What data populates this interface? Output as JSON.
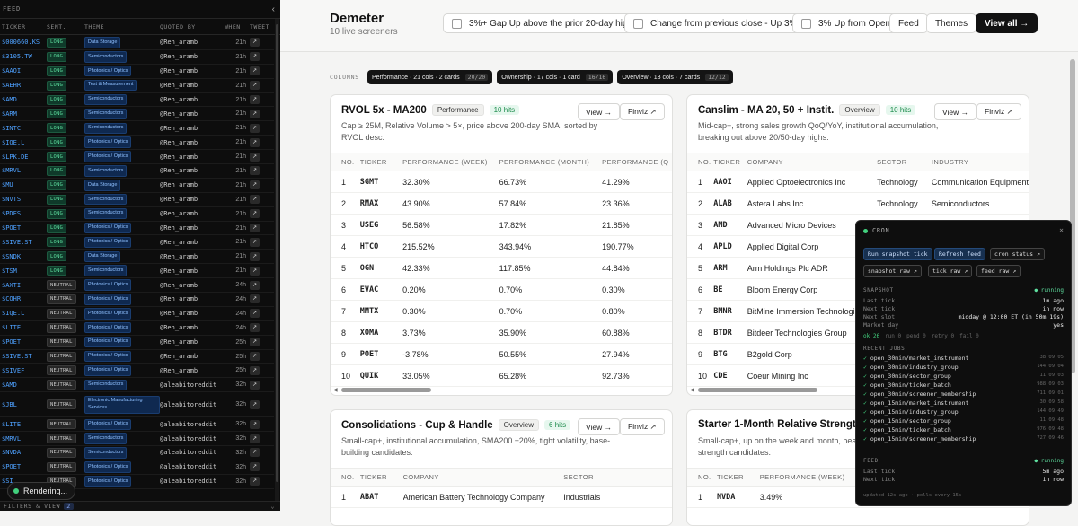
{
  "feed": {
    "label": "FEED",
    "collapse_icon": "chevron-left-icon",
    "columns": [
      "TICKER",
      "SENT.",
      "THEME",
      "QUOTED BY",
      "WHEN",
      "TWEET"
    ],
    "rows": [
      {
        "ticker": "$000660.KS",
        "sent": "LONG",
        "theme": "Data Storage",
        "quoted": "@Ren_aramb",
        "when": "21h"
      },
      {
        "ticker": "$3105.TW",
        "sent": "LONG",
        "theme": "Semiconductors",
        "quoted": "@Ren_aramb",
        "when": "21h"
      },
      {
        "ticker": "$AAOI",
        "sent": "LONG",
        "theme": "Photonics / Optics",
        "quoted": "@Ren_aramb",
        "when": "21h"
      },
      {
        "ticker": "$AEHR",
        "sent": "LONG",
        "theme": "Test & Measurement",
        "quoted": "@Ren_aramb",
        "when": "21h"
      },
      {
        "ticker": "$AMD",
        "sent": "LONG",
        "theme": "Semiconductors",
        "quoted": "@Ren_aramb",
        "when": "21h"
      },
      {
        "ticker": "$ARM",
        "sent": "LONG",
        "theme": "Semiconductors",
        "quoted": "@Ren_aramb",
        "when": "21h"
      },
      {
        "ticker": "$INTC",
        "sent": "LONG",
        "theme": "Semiconductors",
        "quoted": "@Ren_aramb",
        "when": "21h"
      },
      {
        "ticker": "$IQE.L",
        "sent": "LONG",
        "theme": "Photonics / Optics",
        "quoted": "@Ren_aramb",
        "when": "21h"
      },
      {
        "ticker": "$LPK.DE",
        "sent": "LONG",
        "theme": "Photonics / Optics",
        "quoted": "@Ren_aramb",
        "when": "21h"
      },
      {
        "ticker": "$MRVL",
        "sent": "LONG",
        "theme": "Semiconductors",
        "quoted": "@Ren_aramb",
        "when": "21h"
      },
      {
        "ticker": "$MU",
        "sent": "LONG",
        "theme": "Data Storage",
        "quoted": "@Ren_aramb",
        "when": "21h"
      },
      {
        "ticker": "$NVTS",
        "sent": "LONG",
        "theme": "Semiconductors",
        "quoted": "@Ren_aramb",
        "when": "21h"
      },
      {
        "ticker": "$PDFS",
        "sent": "LONG",
        "theme": "Semiconductors",
        "quoted": "@Ren_aramb",
        "when": "21h"
      },
      {
        "ticker": "$POET",
        "sent": "LONG",
        "theme": "Photonics / Optics",
        "quoted": "@Ren_aramb",
        "when": "21h"
      },
      {
        "ticker": "$SIVE.ST",
        "sent": "LONG",
        "theme": "Photonics / Optics",
        "quoted": "@Ren_aramb",
        "when": "21h"
      },
      {
        "ticker": "$SNDK",
        "sent": "LONG",
        "theme": "Data Storage",
        "quoted": "@Ren_aramb",
        "when": "21h"
      },
      {
        "ticker": "$TSM",
        "sent": "LONG",
        "theme": "Semiconductors",
        "quoted": "@Ren_aramb",
        "when": "21h"
      },
      {
        "ticker": "$AXTI",
        "sent": "NEUTRAL",
        "theme": "Photonics / Optics",
        "quoted": "@Ren_aramb",
        "when": "24h"
      },
      {
        "ticker": "$COHR",
        "sent": "NEUTRAL",
        "theme": "Photonics / Optics",
        "quoted": "@Ren_aramb",
        "when": "24h"
      },
      {
        "ticker": "$IQE.L",
        "sent": "NEUTRAL",
        "theme": "Photonics / Optics",
        "quoted": "@Ren_aramb",
        "when": "24h"
      },
      {
        "ticker": "$LITE",
        "sent": "NEUTRAL",
        "theme": "Photonics / Optics",
        "quoted": "@Ren_aramb",
        "when": "24h"
      },
      {
        "ticker": "$POET",
        "sent": "NEUTRAL",
        "theme": "Photonics / Optics",
        "quoted": "@Ren_aramb",
        "when": "25h"
      },
      {
        "ticker": "$SIVE.ST",
        "sent": "NEUTRAL",
        "theme": "Photonics / Optics",
        "quoted": "@Ren_aramb",
        "when": "25h"
      },
      {
        "ticker": "$SIVEF",
        "sent": "NEUTRAL",
        "theme": "Photonics / Optics",
        "quoted": "@Ren_aramb",
        "when": "25h"
      },
      {
        "ticker": "$AMD",
        "sent": "NEUTRAL",
        "theme": "Semiconductors",
        "quoted": "@aleabitoreddit",
        "when": "32h"
      },
      {
        "ticker": "$JBL",
        "sent": "NEUTRAL",
        "theme": "Electronic Manufacturing Services",
        "quoted": "@aleabitoreddit",
        "when": "32h",
        "tall": true
      },
      {
        "ticker": "$LITE",
        "sent": "NEUTRAL",
        "theme": "Photonics / Optics",
        "quoted": "@aleabitoreddit",
        "when": "32h"
      },
      {
        "ticker": "$MRVL",
        "sent": "NEUTRAL",
        "theme": "Semiconductors",
        "quoted": "@aleabitoreddit",
        "when": "32h"
      },
      {
        "ticker": "$NVDA",
        "sent": "NEUTRAL",
        "theme": "Semiconductors",
        "quoted": "@aleabitoreddit",
        "when": "32h"
      },
      {
        "ticker": "$POET",
        "sent": "NEUTRAL",
        "theme": "Photonics / Optics",
        "quoted": "@aleabitoreddit",
        "when": "32h"
      },
      {
        "ticker": "$SI",
        "sent": "NEUTRAL",
        "theme": "Photonics / Optics",
        "quoted": "@aleabitoreddit",
        "when": "32h"
      }
    ],
    "tweet_icon": "↗",
    "bottom_label": "FILTERS & VIEW",
    "bottom_count": "2",
    "bottom_icon": "chevron-down-icon",
    "rendering_label": "Rendering..."
  },
  "header": {
    "title": "Demeter",
    "subtitle": "10 live screeners",
    "filters": [
      {
        "label": "3%+ Gap Up above the prior 20-day high"
      },
      {
        "label": "Change from previous close - Up 3%"
      },
      {
        "label": "3% Up from Open"
      }
    ],
    "feed_label": "Feed",
    "themes_label": "Themes",
    "view_all_label": "View all →"
  },
  "columns": {
    "label": "COLUMNS",
    "pills": [
      {
        "label": "Performance · 21 cols · 2 cards",
        "count": "20/20"
      },
      {
        "label": "Ownership · 17 cols · 1 card",
        "count": "16/16"
      },
      {
        "label": "Overview · 13 cols · 7 cards",
        "count": "12/12"
      }
    ]
  },
  "cards": {
    "rvol": {
      "title": "RVOL 5x - MA200",
      "tag": "Performance",
      "hits": "10 hits",
      "desc": "Cap ≥ 25M, Relative Volume > 5×, price above 200-day SMA, sorted by RVOL desc.",
      "view": "View →",
      "finviz": "Finviz ↗",
      "headers": [
        "NO.",
        "TICKER",
        "PERFORMANCE (WEEK)",
        "PERFORMANCE (MONTH)",
        "PERFORMANCE (Q"
      ],
      "rows": [
        [
          "1",
          "SGMT",
          "32.30%",
          "66.73%",
          "41.29%"
        ],
        [
          "2",
          "RMAX",
          "43.90%",
          "57.84%",
          "23.36%"
        ],
        [
          "3",
          "USEG",
          "56.58%",
          "17.82%",
          "21.85%"
        ],
        [
          "4",
          "HTCO",
          "215.52%",
          "343.94%",
          "190.77%"
        ],
        [
          "5",
          "OGN",
          "42.33%",
          "117.85%",
          "44.84%"
        ],
        [
          "6",
          "EVAC",
          "0.20%",
          "0.70%",
          "0.30%"
        ],
        [
          "7",
          "MMTX",
          "0.30%",
          "0.70%",
          "0.80%"
        ],
        [
          "8",
          "XOMA",
          "3.73%",
          "35.90%",
          "60.88%"
        ],
        [
          "9",
          "POET",
          "-3.78%",
          "50.55%",
          "27.94%"
        ],
        [
          "10",
          "QUIK",
          "33.05%",
          "65.28%",
          "92.73%"
        ]
      ]
    },
    "canslim": {
      "title": "Canslim - MA 20, 50 + Instit.",
      "tag": "Overview",
      "hits": "10 hits",
      "desc": "Mid-cap+, strong sales growth QoQ/YoY, institutional accumulation, breaking out above 20/50-day highs.",
      "view": "View →",
      "finviz": "Finviz ↗",
      "headers": [
        "NO.",
        "TICKER",
        "COMPANY",
        "SECTOR",
        "INDUSTRY"
      ],
      "rows": [
        [
          "1",
          "AAOI",
          "Applied Optoelectronics Inc",
          "Technology",
          "Communication Equipment"
        ],
        [
          "2",
          "ALAB",
          "Astera Labs Inc",
          "Technology",
          "Semiconductors"
        ],
        [
          "3",
          "AMD",
          "Advanced Micro Devices",
          "",
          ""
        ],
        [
          "4",
          "APLD",
          "Applied Digital Corp",
          "",
          ""
        ],
        [
          "5",
          "ARM",
          "Arm Holdings Plc ADR",
          "",
          ""
        ],
        [
          "6",
          "BE",
          "Bloom Energy Corp",
          "",
          ""
        ],
        [
          "7",
          "BMNR",
          "BitMine Immersion Technologies",
          "",
          ""
        ],
        [
          "8",
          "BTDR",
          "Bitdeer Technologies Group",
          "",
          ""
        ],
        [
          "9",
          "BTG",
          "B2gold Corp",
          "",
          ""
        ],
        [
          "10",
          "CDE",
          "Coeur Mining Inc",
          "",
          ""
        ]
      ]
    },
    "consol": {
      "title": "Consolidations - Cup & Handle",
      "tag": "Overview",
      "hits": "6 hits",
      "desc": "Small-cap+, institutional accumulation, SMA200 ±20%, tight volatility, base-building candidates.",
      "view": "View →",
      "finviz": "Finviz ↗",
      "headers": [
        "NO.",
        "TICKER",
        "COMPANY",
        "SECTOR"
      ],
      "rows": [
        [
          "1",
          "ABAT",
          "American Battery Technology Company",
          "Industrials"
        ]
      ]
    },
    "starter": {
      "title": "Starter 1-Month Relative Strength",
      "desc": "Small-cap+, up on the week and month, heavy volume, early-stage relative strength candidates.",
      "headers": [
        "NO.",
        "TICKER",
        "PERFORMANCE (WEEK)"
      ],
      "rows": [
        [
          "1",
          "NVDA",
          "3.49%"
        ]
      ]
    }
  },
  "cron": {
    "title": "CRON",
    "close": "×",
    "buttons": {
      "run": "Run snapshot tick",
      "refresh": "Refresh feed",
      "status": "cron status ↗",
      "snap_raw": "snapshot raw ↗",
      "tick_raw": "tick raw ↗",
      "feed_raw": "feed raw ↗"
    },
    "snapshot": {
      "label": "SNAPSHOT",
      "state": "● running",
      "last_tick_k": "Last tick",
      "last_tick_v": "1m ago",
      "next_tick_k": "Next tick",
      "next_tick_v": "in now",
      "next_slot_k": "Next slot",
      "next_slot_v": "midday @ 12:00 ET (in 50m 19s)",
      "market_day_k": "Market day",
      "market_day_v": "yes"
    },
    "stats": {
      "ok": "ok 26",
      "run": "run 0",
      "pend": "pend 0",
      "retry": "retry 0",
      "fail": "fail 0"
    },
    "recent_label": "RECENT JOBS",
    "jobs": [
      {
        "name": "open_30min/market_instrument",
        "ts": "38 09:05"
      },
      {
        "name": "open_30min/industry_group",
        "ts": "144 09:04"
      },
      {
        "name": "open_30min/sector_group",
        "ts": "11 09:03"
      },
      {
        "name": "open_30min/ticker_batch",
        "ts": "988 09:03"
      },
      {
        "name": "open_30min/screener_membership",
        "ts": "711 09:01"
      },
      {
        "name": "open_15min/market_instrument",
        "ts": "30 09:58"
      },
      {
        "name": "open_15min/industry_group",
        "ts": "144 09:49"
      },
      {
        "name": "open_15min/sector_group",
        "ts": "11 09:48"
      },
      {
        "name": "open_15min/ticker_batch",
        "ts": "976 09:48"
      },
      {
        "name": "open_15min/screener_membership",
        "ts": "727 09:46"
      }
    ],
    "feed": {
      "label": "FEED",
      "state": "● running",
      "last_tick_k": "Last tick",
      "last_tick_v": "5m ago",
      "next_tick_k": "Next tick",
      "next_tick_v": "in now"
    },
    "footer": "updated 12s ago · polls every 15s"
  }
}
